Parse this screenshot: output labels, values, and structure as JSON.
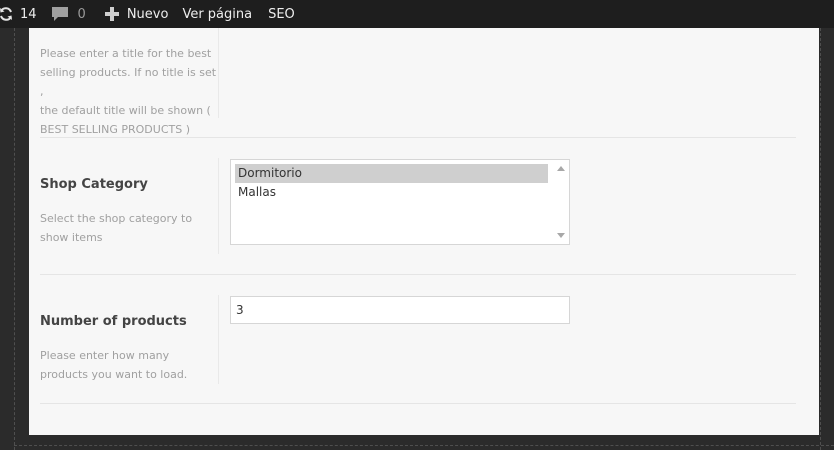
{
  "adminbar": {
    "updates_count": "14",
    "comments_count": "0",
    "new_label": "Nuevo",
    "view_page_label": "Ver página",
    "seo_label": "SEO"
  },
  "sections": {
    "best_selling_title": {
      "desc_lines": [
        "Please enter a title for the best",
        "selling products. If no title is set ,",
        "the default title will be shown (",
        "BEST SELLING PRODUCTS )"
      ]
    },
    "shop_category": {
      "title": "Shop Category",
      "desc_lines": [
        "Select the shop category to",
        "show items"
      ],
      "options": [
        "Dormitorio",
        "Mallas"
      ],
      "selected": "Dormitorio"
    },
    "number_of_products": {
      "title": "Number of products",
      "desc_lines": [
        "Please enter how many",
        "products you want to load."
      ],
      "value": "3"
    }
  },
  "colors": {
    "adminbar_bg": "#1e1e1e",
    "panel_bg": "#f7f7f7",
    "selected_option_bg": "#cfcfcf"
  }
}
